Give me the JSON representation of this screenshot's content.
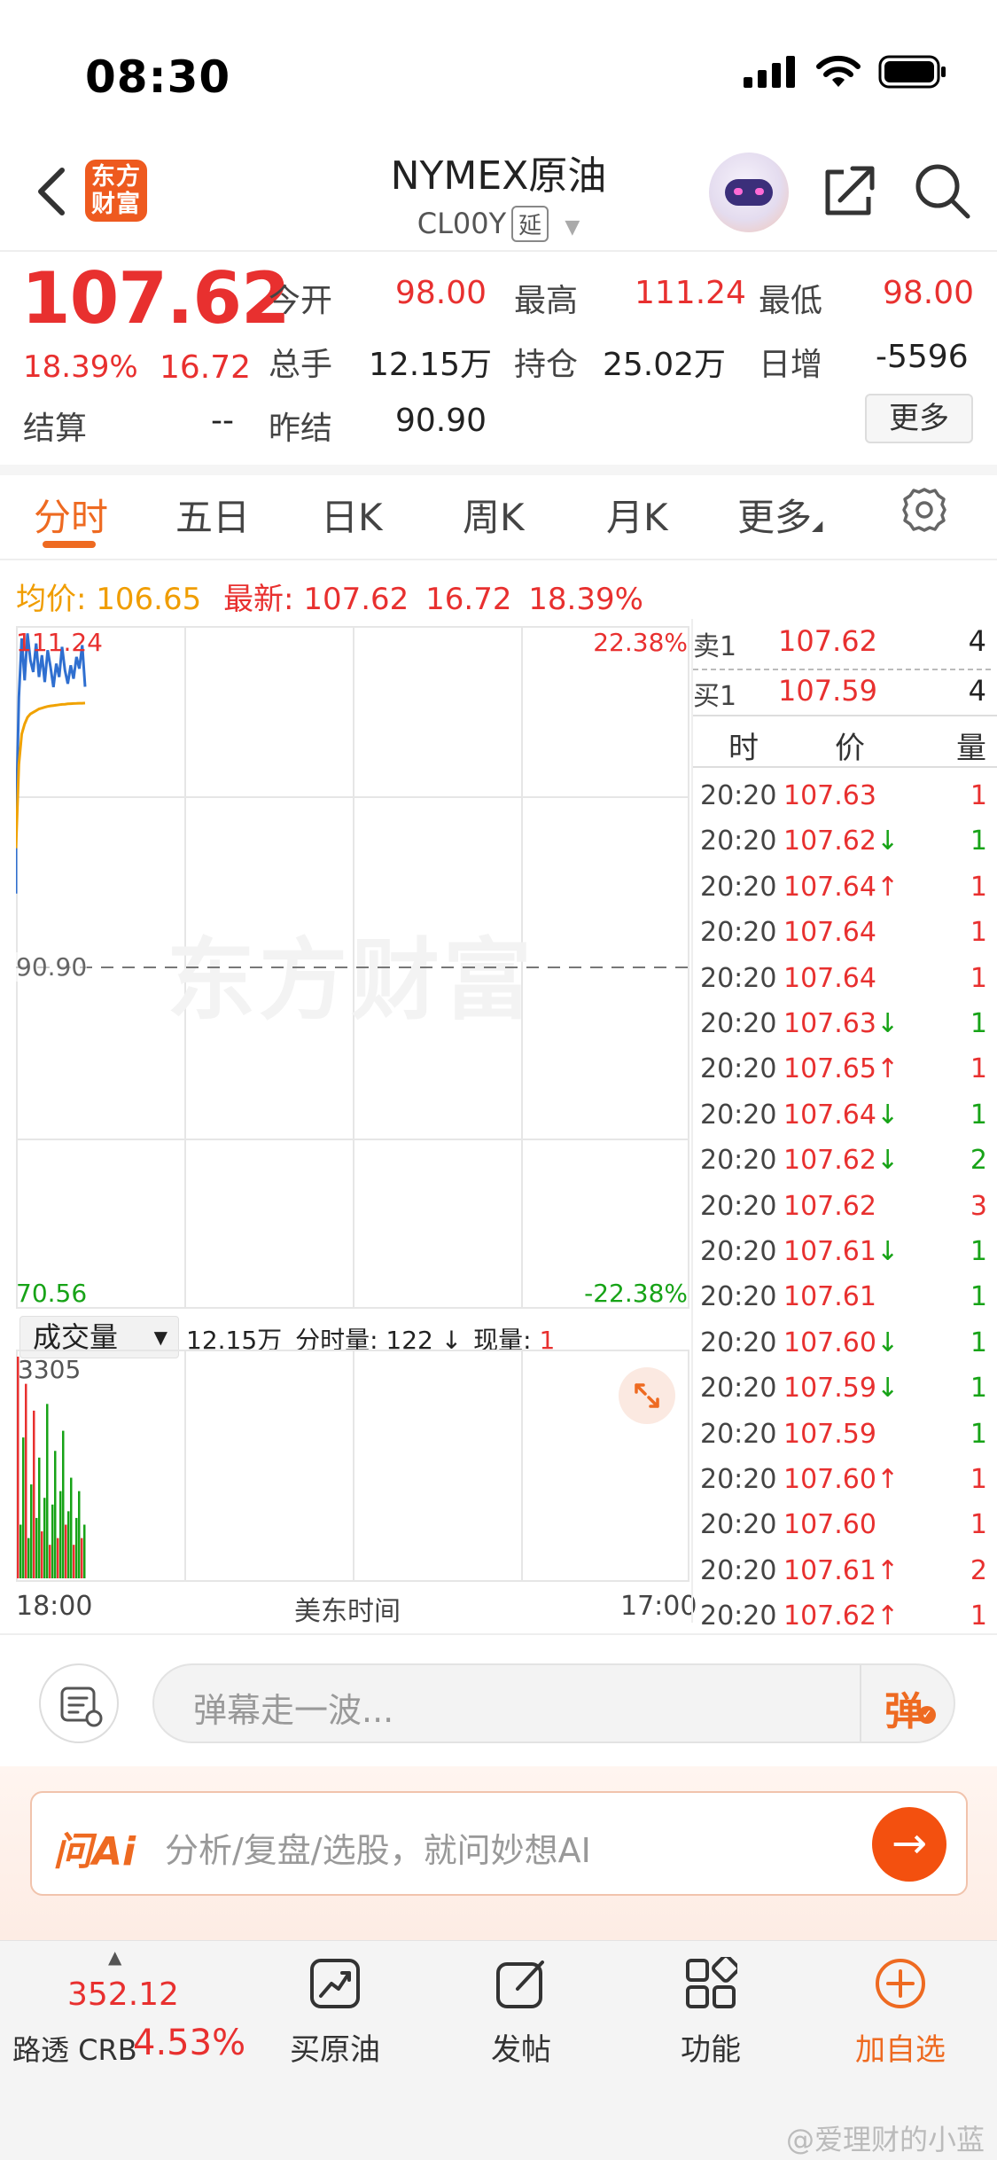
{
  "status_bar": {
    "time": "08:30"
  },
  "header": {
    "title": "NYMEX原油",
    "code": "CL00Y",
    "delay_badge": "延",
    "brand_logo_text": "东方财富"
  },
  "quote": {
    "price": "107.62",
    "change_pct": "18.39%",
    "change": "16.72",
    "fields": [
      {
        "label": "今开",
        "value": "98.00",
        "color": "#e8302f"
      },
      {
        "label": "最高",
        "value": "111.24",
        "color": "#e8302f"
      },
      {
        "label": "最低",
        "value": "98.00",
        "color": "#e8302f"
      },
      {
        "label": "总手",
        "value": "12.15万",
        "color": "#222222"
      },
      {
        "label": "持仓",
        "value": "25.02万",
        "color": "#222222"
      },
      {
        "label": "日增",
        "value": "-5596",
        "color": "#222222"
      },
      {
        "label": "结算",
        "value": "--",
        "color": "#222222"
      },
      {
        "label": "昨结",
        "value": "90.90",
        "color": "#222222"
      }
    ],
    "more_button": "更多"
  },
  "tabs": [
    "分时",
    "五日",
    "日K",
    "周K",
    "月K",
    "更多"
  ],
  "chart_info": {
    "avg_label": "均价:",
    "avg_value": "106.65",
    "latest_label": "最新:",
    "latest_price": "107.62",
    "latest_change": "16.72",
    "latest_pct": "18.39%"
  },
  "chart_data": {
    "type": "line",
    "y_max": "111.24",
    "y_mid": "90.90",
    "y_min": "70.56",
    "pct_max": "22.38%",
    "pct_min": "-22.38%",
    "x_start": "18:00",
    "x_mid": "美东时间",
    "x_end": "17:00",
    "ylim": [
      70.56,
      111.24
    ],
    "series": [
      {
        "values": [
          99.0,
          107.0,
          110.5,
          108.0,
          110.8,
          109.2,
          108.5,
          110.2,
          108.2,
          109.5,
          107.9,
          109.8,
          108.8,
          107.6,
          109.0,
          108.2,
          110.0,
          108.6,
          107.8,
          108.9,
          108.1,
          109.4,
          108.7,
          110.1,
          107.62
        ]
      },
      {
        "values": [
          98.0,
          103.0,
          104.8,
          105.4,
          105.8,
          106.0,
          106.1,
          106.2,
          106.3,
          106.35,
          106.4,
          106.45,
          106.48,
          106.5,
          106.52,
          106.55,
          106.57,
          106.58,
          106.6,
          106.61,
          106.62,
          106.63,
          106.64,
          106.64,
          106.65
        ]
      }
    ],
    "volume": {
      "max_label": "3305",
      "values": [
        3305,
        800,
        2100,
        2900,
        600,
        1400,
        2500,
        900,
        1800,
        700,
        1200,
        2600,
        500,
        1100,
        1900,
        600,
        1300,
        2200,
        800,
        1000,
        1500,
        500,
        900,
        1300,
        600,
        800
      ]
    }
  },
  "volume_panel": {
    "selector": "成交量",
    "total": "12.15万",
    "tick_vol_label": "分时量:",
    "tick_vol": "122",
    "now_vol_label": "现量:",
    "now_vol": "1"
  },
  "order_book": {
    "ask_label": "卖1",
    "ask_price": "107.62",
    "ask_vol": "4",
    "bid_label": "买1",
    "bid_price": "107.59",
    "bid_vol": "4"
  },
  "trades_header": {
    "time": "时",
    "price": "价",
    "vol": "量"
  },
  "trades": [
    {
      "time": "20:20",
      "price": "107.63",
      "arrow": "",
      "vol": "1",
      "vol_color": "#e8302f"
    },
    {
      "time": "20:20",
      "price": "107.62",
      "arrow": "↓",
      "vol": "1",
      "vol_color": "#17a317"
    },
    {
      "time": "20:20",
      "price": "107.64",
      "arrow": "↑",
      "vol": "1",
      "vol_color": "#e8302f"
    },
    {
      "time": "20:20",
      "price": "107.64",
      "arrow": "",
      "vol": "1",
      "vol_color": "#e8302f"
    },
    {
      "time": "20:20",
      "price": "107.64",
      "arrow": "",
      "vol": "1",
      "vol_color": "#e8302f"
    },
    {
      "time": "20:20",
      "price": "107.63",
      "arrow": "↓",
      "vol": "1",
      "vol_color": "#17a317"
    },
    {
      "time": "20:20",
      "price": "107.65",
      "arrow": "↑",
      "vol": "1",
      "vol_color": "#e8302f"
    },
    {
      "time": "20:20",
      "price": "107.64",
      "arrow": "↓",
      "vol": "1",
      "vol_color": "#17a317"
    },
    {
      "time": "20:20",
      "price": "107.62",
      "arrow": "↓",
      "vol": "2",
      "vol_color": "#17a317"
    },
    {
      "time": "20:20",
      "price": "107.62",
      "arrow": "",
      "vol": "3",
      "vol_color": "#e8302f"
    },
    {
      "time": "20:20",
      "price": "107.61",
      "arrow": "↓",
      "vol": "1",
      "vol_color": "#17a317"
    },
    {
      "time": "20:20",
      "price": "107.61",
      "arrow": "",
      "vol": "1",
      "vol_color": "#17a317"
    },
    {
      "time": "20:20",
      "price": "107.60",
      "arrow": "↓",
      "vol": "1",
      "vol_color": "#17a317"
    },
    {
      "time": "20:20",
      "price": "107.59",
      "arrow": "↓",
      "vol": "1",
      "vol_color": "#17a317"
    },
    {
      "time": "20:20",
      "price": "107.59",
      "arrow": "",
      "vol": "1",
      "vol_color": "#17a317"
    },
    {
      "time": "20:20",
      "price": "107.60",
      "arrow": "↑",
      "vol": "1",
      "vol_color": "#e8302f"
    },
    {
      "time": "20:20",
      "price": "107.60",
      "arrow": "",
      "vol": "1",
      "vol_color": "#e8302f"
    },
    {
      "time": "20:20",
      "price": "107.61",
      "arrow": "↑",
      "vol": "2",
      "vol_color": "#e8302f"
    },
    {
      "time": "20:20",
      "price": "107.62",
      "arrow": "↑",
      "vol": "1",
      "vol_color": "#e8302f"
    }
  ],
  "danmaku": {
    "placeholder": "弹幕走一波...",
    "button": "弹"
  },
  "ai_bar": {
    "logo": "问Ai",
    "placeholder": "分析/复盘/选股，就问妙想AI"
  },
  "bottom": {
    "index_value": "352.12",
    "index_name": "路透 CRB",
    "index_pct": "4.53%",
    "items": [
      "买原油",
      "发帖",
      "功能",
      "加自选"
    ]
  },
  "watermark": "东方财富",
  "credit": "@爱理财的小蓝"
}
